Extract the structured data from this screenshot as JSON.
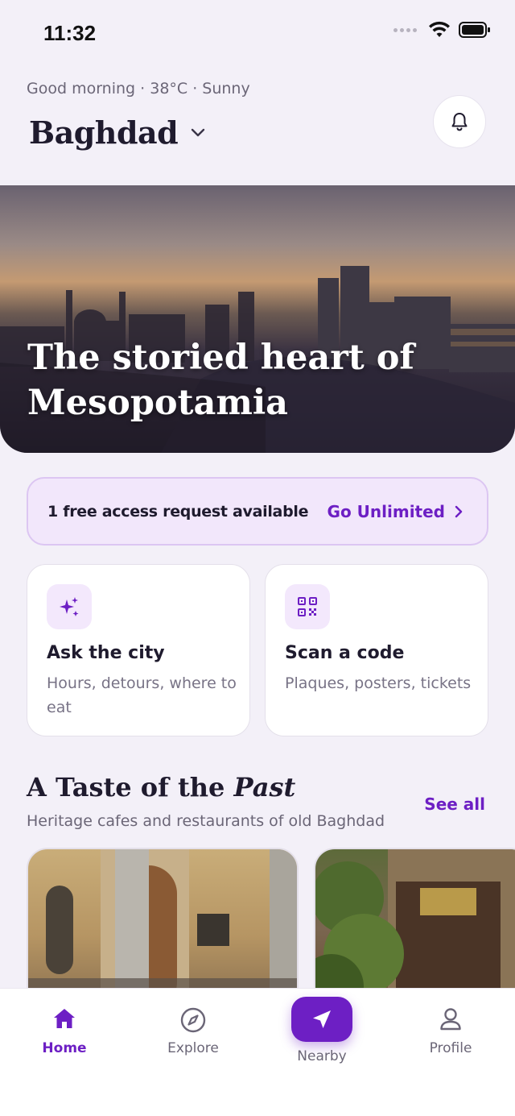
{
  "status_bar": {
    "time": "11:32"
  },
  "header": {
    "greeting": "Good morning · 38°C · Sunny",
    "city": "Baghdad"
  },
  "hero": {
    "title": "The storied heart of Mesopotamia"
  },
  "access_banner": {
    "text": "1 free access request available",
    "link_label": "Go Unlimited"
  },
  "actions": [
    {
      "title": "Ask the city",
      "subtitle": "Hours, detours, where to eat",
      "icon": "sparkles-icon"
    },
    {
      "title": "Scan a code",
      "subtitle": "Plaques, posters, tickets",
      "icon": "qr-code-icon"
    }
  ],
  "section": {
    "title_prefix": "A Taste of the",
    "title_emphasis": "Past",
    "subtitle": "Heritage cafes and restaurants of old Baghdad",
    "see_all": "See all"
  },
  "tabs": [
    {
      "label": "Home",
      "icon": "home-icon",
      "active": true
    },
    {
      "label": "Explore",
      "icon": "compass-icon",
      "active": false
    },
    {
      "label": "Nearby",
      "icon": "navigation-arrow-icon",
      "active": false
    },
    {
      "label": "Profile",
      "icon": "user-icon",
      "active": false
    }
  ],
  "colors": {
    "accent": "#6d1fc4",
    "background": "#f3f0f8",
    "banner_bg": "#f2e7fb"
  }
}
